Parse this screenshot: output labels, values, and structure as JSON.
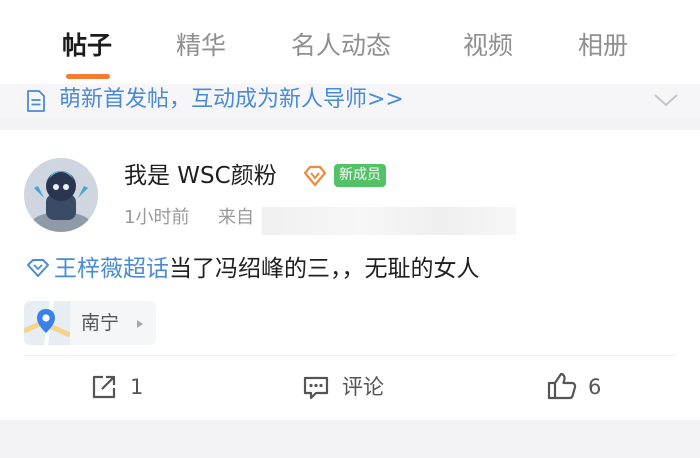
{
  "tabs": [
    {
      "label": "帖子",
      "active": true
    },
    {
      "label": "精华",
      "active": false
    },
    {
      "label": "名人动态",
      "active": false
    },
    {
      "label": "视频",
      "active": false
    },
    {
      "label": "相册",
      "active": false
    }
  ],
  "notice": {
    "icon": "document-icon",
    "text": "萌新首发帖，互动成为新人导师>>"
  },
  "post": {
    "author": {
      "name": "我是 WSC颜粉",
      "badge": "新成员"
    },
    "time": "1小时前",
    "from_label": "来自",
    "topic": "王梓薇超话",
    "content": "当了冯绍峰的三，，无耻的女人",
    "location": "南宁",
    "actions": {
      "repost_count": "1",
      "comment_label": "评论",
      "like_count": "6"
    }
  },
  "colors": {
    "accent": "#f47d31",
    "link": "#4a8bd6",
    "member_badge": "#52c266"
  }
}
